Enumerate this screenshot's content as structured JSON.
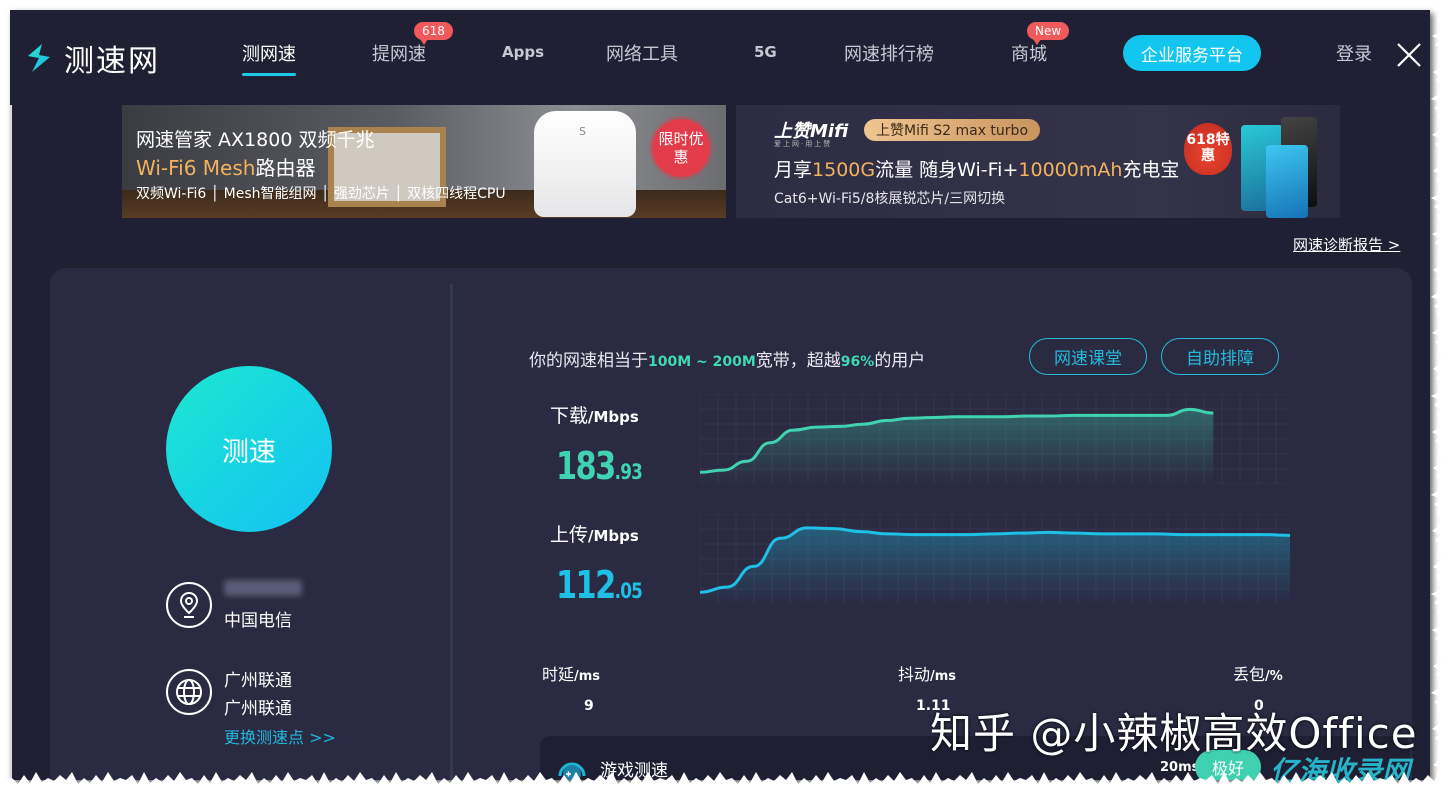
{
  "nav": {
    "logo_text": "测速网",
    "items": [
      {
        "label": "测网速",
        "active": true
      },
      {
        "label": "提网速",
        "badge": "618"
      },
      {
        "label": "Apps"
      },
      {
        "label": "网络工具"
      },
      {
        "label": "5G"
      },
      {
        "label": "网速排行榜"
      },
      {
        "label": "商城",
        "badge": "New"
      }
    ],
    "enterprise_label": "企业服务平台",
    "login_label": "登录"
  },
  "banners": [
    {
      "title": "网速管家 AX1800 双频千兆",
      "subtitle_highlight": "Wi-Fi6 Mesh",
      "subtitle_rest": "路由器",
      "features": "双频Wi-Fi6 │ Mesh智能组网 │ 强劲芯片 │ 双核四线程CPU",
      "promo_badge": "限时优惠"
    },
    {
      "brand": "上赞Mifi",
      "brand_sub": "爱上网·用上赞",
      "product_pill": "上赞Mifi S2 max turbo",
      "title_parts": [
        "月享",
        "1500G",
        "流量  随身Wi-Fi+",
        "10000mAh",
        "充电宝"
      ],
      "features": "Cat6+Wi-Fi5/8核展锐芯片/三网切换",
      "promo_badge": "618特惠"
    }
  ],
  "report_link": "网速诊断报告 >",
  "left_panel": {
    "speed_test_button": "测速",
    "isp": "中国电信",
    "server_name": "广州联通",
    "server_sub": "广州联通",
    "change_server_link": "更换测速点 >>"
  },
  "summary": {
    "prefix": "你的网速相当于",
    "bandwidth": "100M ~ 200M",
    "middle": "宽带，超越",
    "percentile": "96%",
    "suffix": "的用户"
  },
  "buttons": {
    "speed_class": "网速课堂",
    "self_help": "自助排障"
  },
  "download": {
    "label": "下载",
    "unit": "/Mbps",
    "value_int": "183",
    "value_dec": ".93"
  },
  "upload": {
    "label": "上传",
    "unit": "/Mbps",
    "value_int": "112",
    "value_dec": ".05"
  },
  "stats": [
    {
      "label": "时延",
      "unit": "/ms",
      "value": "9"
    },
    {
      "label": "抖动",
      "unit": "/ms",
      "value": "1.11"
    },
    {
      "label": "丢包",
      "unit": "/%",
      "value": "0"
    }
  ],
  "game": {
    "label": "游戏测速",
    "ping": "20ms",
    "rating": "极好"
  },
  "colors": {
    "download": "#40d3b1",
    "upload": "#1ec0e6",
    "accent": "#12c6ef",
    "badge": "#f05a5a"
  },
  "chart_data": [
    {
      "type": "area",
      "title": "下载/Mbps",
      "series": [
        {
          "name": "download",
          "values": [
            0.05,
            0.08,
            0.2,
            0.45,
            0.62,
            0.66,
            0.67,
            0.7,
            0.75,
            0.78,
            0.79,
            0.8,
            0.8,
            0.8,
            0.81,
            0.81,
            0.82,
            0.82,
            0.82,
            0.82,
            0.82,
            0.9,
            0.85
          ]
        }
      ],
      "progress": 0.87,
      "grid": true
    },
    {
      "type": "area",
      "title": "上传/Mbps",
      "series": [
        {
          "name": "upload",
          "values": [
            0.05,
            0.12,
            0.4,
            0.78,
            0.92,
            0.91,
            0.87,
            0.84,
            0.83,
            0.83,
            0.83,
            0.84,
            0.85,
            0.86,
            0.85,
            0.84,
            0.84,
            0.84,
            0.83,
            0.83,
            0.83,
            0.83,
            0.82
          ]
        }
      ],
      "progress": 1.0,
      "grid": true
    }
  ],
  "watermark": "知乎 @小辣椒高效Office",
  "watermark_2": "亿海收录网"
}
